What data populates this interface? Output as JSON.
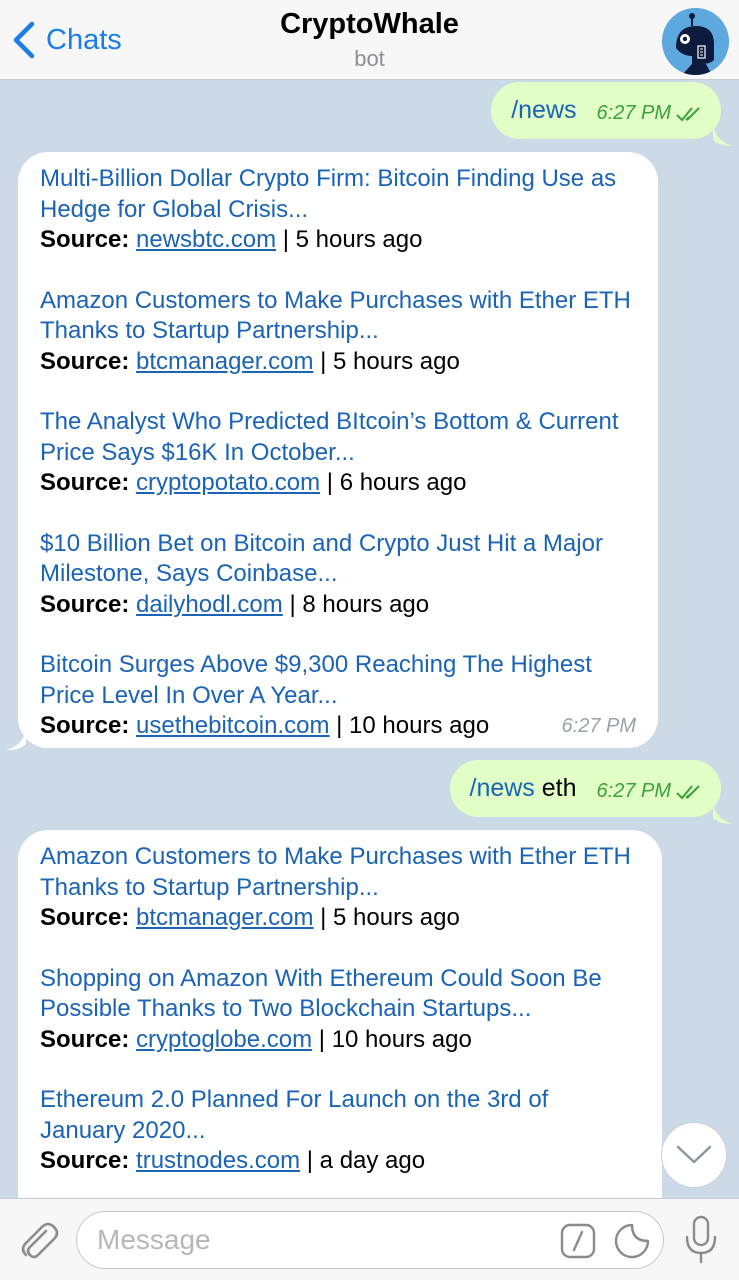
{
  "header": {
    "back_label": "Chats",
    "title": "CryptoWhale",
    "subtitle": "bot"
  },
  "messages": {
    "out1": {
      "cmd": "/news",
      "arg": "",
      "time": "6:27 PM"
    },
    "in1": {
      "time": "6:27 PM",
      "items": [
        {
          "title": "Multi-Billion Dollar Crypto Firm: Bitcoin Finding Use as Hedge for Global Crisis...",
          "source_label": "Source:",
          "source": "newsbtc.com",
          "age": " | 5 hours ago"
        },
        {
          "title": "Amazon Customers to Make Purchases with Ether ETH Thanks to Startup Partnership...",
          "source_label": "Source:",
          "source": "btcmanager.com",
          "age": " | 5 hours ago"
        },
        {
          "title": "The Analyst Who Predicted BItcoin’s Bottom & Current Price Says $16K In October...",
          "source_label": "Source:",
          "source": "cryptopotato.com",
          "age": " | 6 hours ago"
        },
        {
          "title": "$10 Billion Bet on Bitcoin and Crypto Just Hit a Major Milestone, Says Coinbase...",
          "source_label": "Source:",
          "source": "dailyhodl.com",
          "age": " | 8 hours ago"
        },
        {
          "title": "Bitcoin Surges Above $9,300 Reaching The Highest Price Level In Over A Year...",
          "source_label": "Source:",
          "source": "usethebitcoin.com",
          "age": " | 10 hours ago"
        }
      ]
    },
    "out2": {
      "cmd": "/news",
      "arg": " eth",
      "time": "6:27 PM"
    },
    "in2": {
      "items": [
        {
          "title": "Amazon Customers to Make Purchases with Ether ETH Thanks to Startup Partnership...",
          "source_label": "Source:",
          "source": "btcmanager.com",
          "age": " | 5 hours ago"
        },
        {
          "title": "Shopping on Amazon With Ethereum Could Soon Be Possible Thanks to Two Blockchain Startups...",
          "source_label": "Source:",
          "source": "cryptoglobe.com",
          "age": " | 10 hours ago"
        },
        {
          "title": "Ethereum 2.0 Planned For Launch on the 3rd of January 2020...",
          "source_label": "Source:",
          "source": "trustnodes.com",
          "age": " | a day ago"
        }
      ]
    }
  },
  "input": {
    "placeholder": "Message"
  },
  "icons": {
    "back": "chevron-left-icon",
    "attach": "paperclip-icon",
    "commands": "slash-command-icon",
    "sticker": "sticker-icon",
    "mic": "microphone-icon",
    "scroll": "chevron-down-icon",
    "read": "double-check-icon"
  },
  "colors": {
    "link": "#1a63b5",
    "accent": "#1a7de8",
    "outgoing_bubble": "#e1fec6",
    "read_ticks": "#3ca03c",
    "chat_background": "#ccd9e6"
  }
}
